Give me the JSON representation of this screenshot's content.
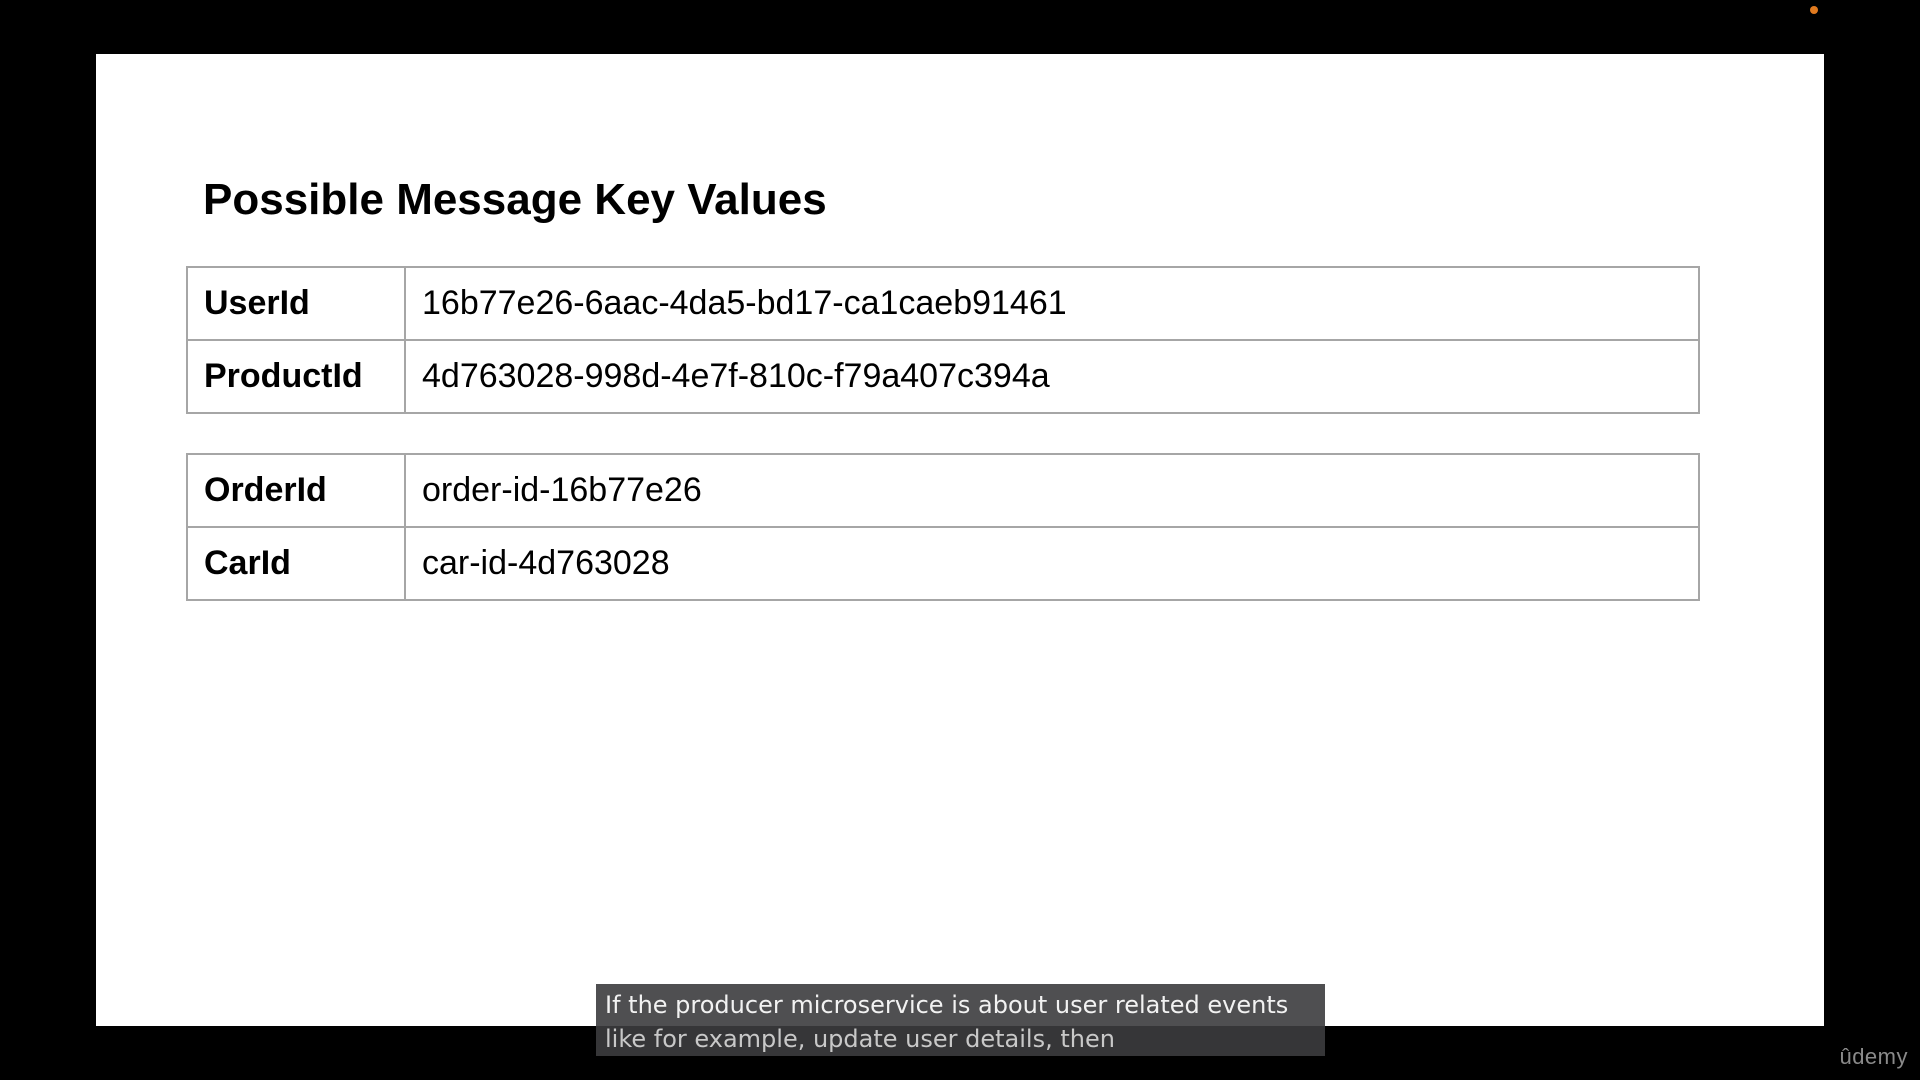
{
  "slide": {
    "title": "Possible Message Key Values",
    "tables": [
      {
        "rows": [
          {
            "key": "UserId",
            "value": "16b77e26-6aac-4da5-bd17-ca1caeb91461"
          },
          {
            "key": "ProductId",
            "value": "4d763028-998d-4e7f-810c-f79a407c394a"
          }
        ]
      },
      {
        "rows": [
          {
            "key": "OrderId",
            "value": "order-id-16b77e26"
          },
          {
            "key": "CarId",
            "value": "car-id-4d763028"
          }
        ]
      }
    ]
  },
  "captions": {
    "line1": "If the producer microservice is about user related events",
    "line2": "like for example, update user details, then"
  },
  "branding": {
    "logo_text": "ûdemy"
  },
  "colors": {
    "background": "#000000",
    "slide": "#ffffff",
    "table_border": "#a6a6a6",
    "caption_bg": "#3c3c3e",
    "status_dot": "#e07a1f"
  }
}
